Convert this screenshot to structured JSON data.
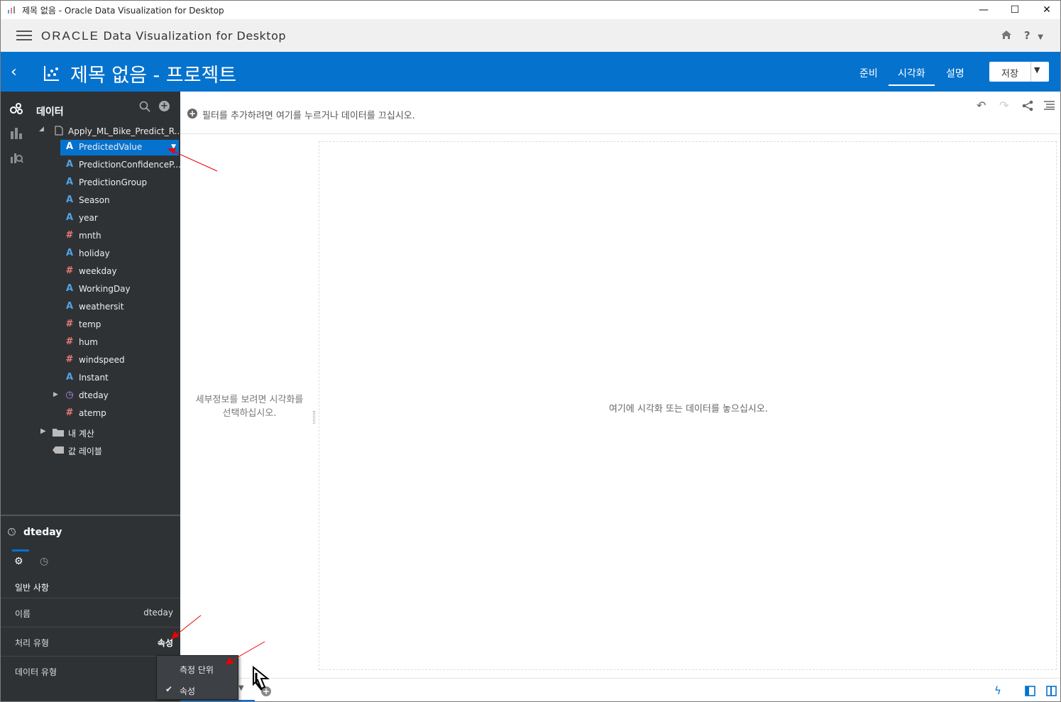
{
  "window": {
    "title": "제목 없음 - Oracle Data Visualization for Desktop",
    "minimize": "—",
    "maximize": "☐",
    "close": "✕"
  },
  "header": {
    "brand": "ORACLE",
    "product": "Data Visualization for Desktop",
    "home_icon": "home-icon",
    "help": "?"
  },
  "project": {
    "title": "제목 없음 - 프로젝트",
    "tabs": [
      "준비",
      "시각화",
      "설명"
    ],
    "active_tab": "시각화",
    "save_label": "저장"
  },
  "data_panel": {
    "title": "데이터",
    "dataset": "Apply_ML_Bike_Predict_R...",
    "columns": [
      {
        "name": "PredictedValue",
        "type": "attribute",
        "selected": true
      },
      {
        "name": "PredictionConfidenceP...",
        "type": "attribute"
      },
      {
        "name": "PredictionGroup",
        "type": "attribute"
      },
      {
        "name": "Season",
        "type": "attribute"
      },
      {
        "name": "year",
        "type": "attribute"
      },
      {
        "name": "mnth",
        "type": "measure"
      },
      {
        "name": "holiday",
        "type": "attribute"
      },
      {
        "name": "weekday",
        "type": "measure"
      },
      {
        "name": "WorkingDay",
        "type": "attribute"
      },
      {
        "name": "weathersit",
        "type": "attribute"
      },
      {
        "name": "temp",
        "type": "measure"
      },
      {
        "name": "hum",
        "type": "measure"
      },
      {
        "name": "windspeed",
        "type": "measure"
      },
      {
        "name": "Instant",
        "type": "attribute"
      },
      {
        "name": "dteday",
        "type": "date"
      },
      {
        "name": "atemp",
        "type": "measure"
      }
    ],
    "my_calculations": "내 계산",
    "value_labels": "값 레이블"
  },
  "properties": {
    "title": "dteday",
    "section": "일반 사항",
    "rows": [
      {
        "key": "이름",
        "value": "dteday"
      },
      {
        "key": "처리 유형",
        "value": "속성"
      },
      {
        "key": "데이터 유형",
        "value": ""
      }
    ]
  },
  "popup_menu": {
    "items": [
      {
        "label": "측정 단위",
        "checked": false
      },
      {
        "label": "속성",
        "checked": true
      }
    ]
  },
  "filter_bar": {
    "hint": "필터를 추가하려면 여기를 누르거나 데이터를 끄십시오."
  },
  "details_pane": {
    "message": "세부정보를 보려면 시각화를 선택하십시오."
  },
  "canvas": {
    "message": "여기에 시각화 또는 데이터를 놓으십시오."
  },
  "colors": {
    "accent": "#0572ce",
    "panel": "#2f3235",
    "attribute": "#4fa3e6",
    "measure": "#ee7d7d",
    "date": "#b38cf0"
  }
}
